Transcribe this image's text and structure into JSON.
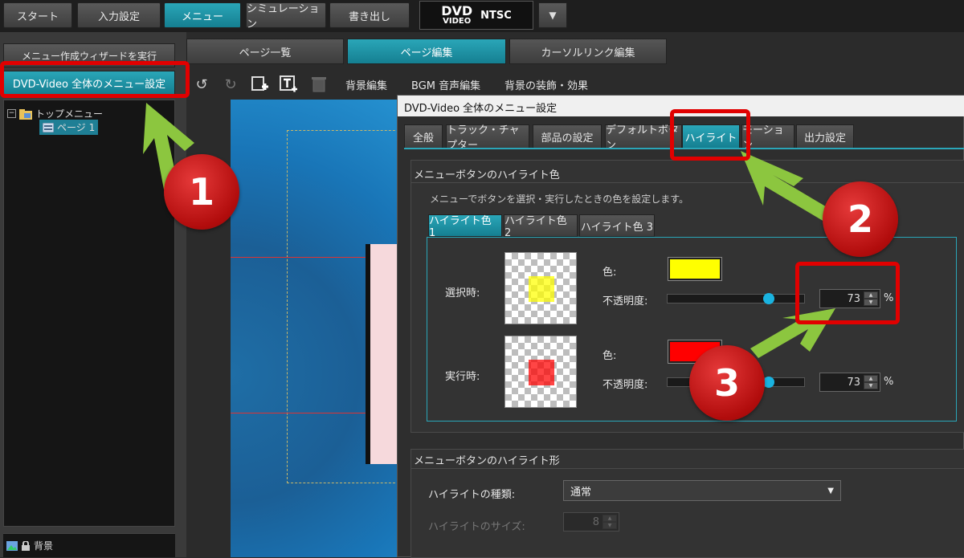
{
  "topnav": {
    "tabs": [
      "スタート",
      "入力設定",
      "メニュー",
      "シミュレーション",
      "書き出し"
    ],
    "active": "メニュー",
    "dvd_logo": {
      "top": "DVD",
      "bottom": "VIDEO"
    },
    "format": "NTSC",
    "dropdown_icon": "▼"
  },
  "left": {
    "wizard_button": "メニュー作成ウィザードを実行",
    "global_settings_button": "DVD-Video 全体のメニュー設定",
    "tree": {
      "expander": "−",
      "root_label": "トップメニュー",
      "child_label": "ページ 1"
    },
    "bottom_item": "背景"
  },
  "editor_tabs": [
    "ページ一覧",
    "ページ編集",
    "カーソルリンク編集"
  ],
  "editor_tabs_active": "ページ編集",
  "toolbar": {
    "icons": [
      "undo-icon",
      "redo-icon",
      "add-page-icon",
      "add-text-icon",
      "delete-icon"
    ],
    "links": [
      "背景編集",
      "BGM 音声編集",
      "背景の装飾・効果"
    ]
  },
  "dialog": {
    "title": "DVD-Video 全体のメニュー設定",
    "tabs": [
      "全般",
      "トラック・チャプター",
      "部品の設定",
      "デフォルトボタン",
      "ハイライト",
      "モーション",
      "出力設定"
    ],
    "active_tab": "ハイライト",
    "color_group": {
      "title": "メニューボタンのハイライト色",
      "description": "メニューでボタンを選択・実行したときの色を設定します。",
      "subtabs": [
        "ハイライト色 1",
        "ハイライト色 2",
        "ハイライト色 3"
      ],
      "active_subtab": "ハイライト色 1",
      "rows": [
        {
          "label": "選択時:",
          "color_label": "色:",
          "color": "#ffff00",
          "opacity_label": "不透明度:",
          "opacity": "73",
          "unit": "%"
        },
        {
          "label": "実行時:",
          "color_label": "色:",
          "color": "#ff0000",
          "opacity_label": "不透明度:",
          "opacity": "73",
          "unit": "%"
        }
      ]
    },
    "shape_group": {
      "title": "メニューボタンのハイライト形",
      "type_label": "ハイライトの種類:",
      "type_value": "通常",
      "size_label": "ハイライトのサイズ:",
      "size_value": "8"
    }
  },
  "annotations": {
    "badges": [
      "1",
      "2",
      "3"
    ],
    "highlight_color": "#e10000",
    "arrow_color": "#8cc63f"
  }
}
